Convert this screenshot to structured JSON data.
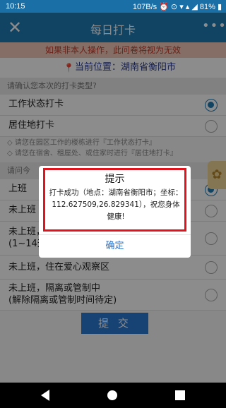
{
  "status_bar": {
    "time": "10:15",
    "right": "107B/s ⏰ ⊙ ▾ ▴ ◢ 81% ▮"
  },
  "titlebar": {
    "close_icon": "✕",
    "title": "每日打卡",
    "more_icon": "•••"
  },
  "warning": "如果非本人操作，此问卷将视为无效",
  "location": {
    "pin_icon": "📍",
    "label": "当前位置：湖南省衡阳市"
  },
  "section1": {
    "header": "请确认您本次的打卡类型?",
    "options": [
      {
        "label": "工作状态打卡",
        "selected": true
      },
      {
        "label": "居住地打卡",
        "selected": false
      }
    ],
    "notes": [
      "◇ 请您在园区工作的楼栋进行『工作状态打卡』",
      "◇ 请您在宿舍、租屋处、或住家时进行『居住地打卡』"
    ]
  },
  "section2": {
    "header": "请问今",
    "options": [
      {
        "label": "上班",
        "selected": true
      },
      {
        "label": "未上班",
        "selected": false
      },
      {
        "label": "未上班，\n(1~14天",
        "selected": false
      },
      {
        "label": "未上班，住在爱心观察区",
        "selected": false
      },
      {
        "label": "未上班，隔离或管制中\n(解除隔离或管制时间待定)",
        "selected": false
      }
    ]
  },
  "submit_label": "提 交",
  "dialog": {
    "title": "提示",
    "message": "打卡成功（地点：湖南省衡阳市；坐标：112.627509,26.829341），祝您身体健康!",
    "ok_label": "确定"
  }
}
